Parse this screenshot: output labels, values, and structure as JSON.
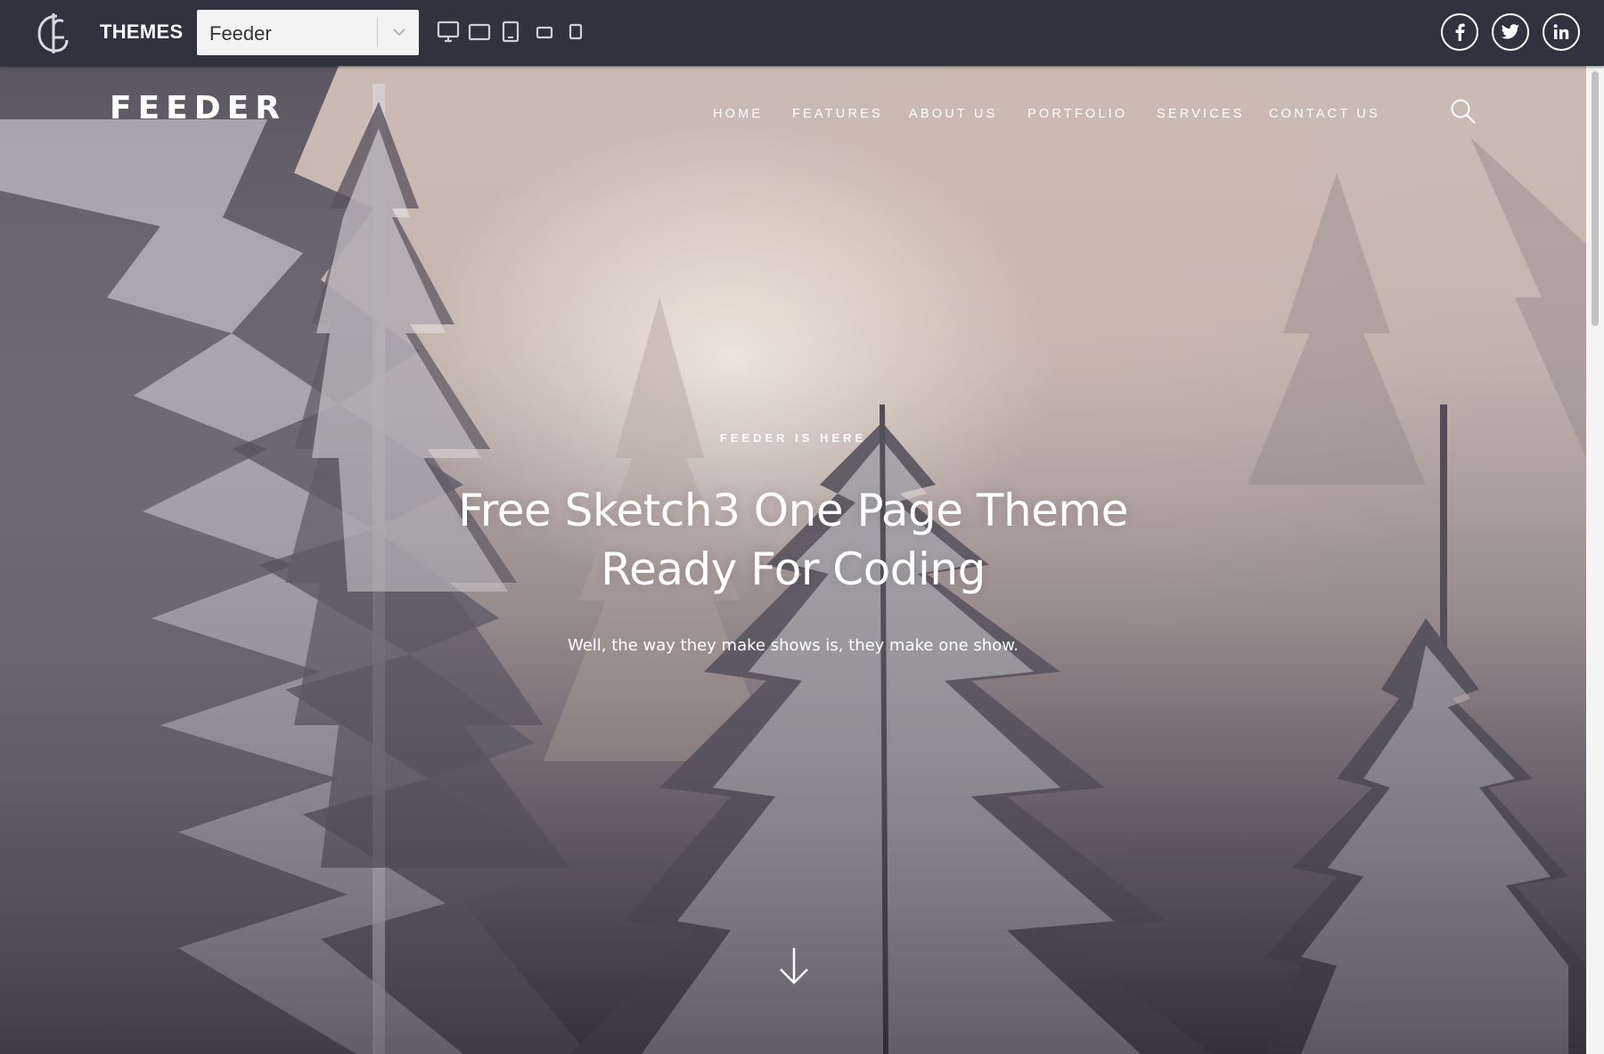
{
  "topbar": {
    "themes_label": "THEMES",
    "theme_select": {
      "value": "Feeder"
    },
    "devices": [
      "desktop-icon",
      "laptop-icon",
      "tablet-icon",
      "tablet-landscape-icon",
      "phone-icon"
    ],
    "social": [
      "facebook-icon",
      "twitter-icon",
      "linkedin-icon"
    ]
  },
  "site": {
    "logo": "FEEDER",
    "nav": [
      "HOME",
      "FEATURES",
      "ABOUT US",
      "PORTFOLIO",
      "SERVICES",
      "CONTACT US"
    ]
  },
  "hero": {
    "kicker": "FEEDER IS HERE",
    "headline_line1": "Free Sketch3 One Page Theme",
    "headline_line2": "Ready For Coding",
    "subline": "Well, the way they make shows is, they make one show."
  },
  "colors": {
    "topbar_bg": "#30323f",
    "text_white": "#ffffff",
    "select_bg": "#f3f3f4"
  }
}
